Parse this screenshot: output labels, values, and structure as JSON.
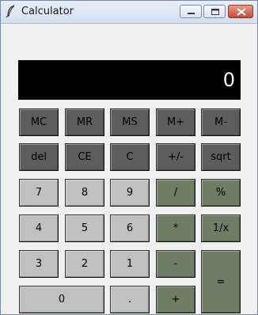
{
  "window": {
    "title": "Calculator"
  },
  "display": {
    "value": "0"
  },
  "colors": {
    "memory_row": "#5d5d5d",
    "digits": "#c0c0c0",
    "operators": "#6f7d65",
    "display_bg": "#000000",
    "display_text": "#ffffff"
  },
  "buttons": {
    "mc": "MC",
    "mr": "MR",
    "ms": "MS",
    "mplus": "M+",
    "mminus": "M-",
    "del": "del",
    "ce": "CE",
    "c": "C",
    "sign": "+/-",
    "sqrt": "sqrt",
    "seven": "7",
    "eight": "8",
    "nine": "9",
    "divide": "/",
    "percent": "%",
    "four": "4",
    "five": "5",
    "six": "6",
    "multiply": "*",
    "reciprocal": "1/x",
    "three": "3",
    "two": "2",
    "one": "1",
    "minus": "-",
    "equals": "=",
    "zero": "0",
    "decimal": ".",
    "plus": "+"
  }
}
